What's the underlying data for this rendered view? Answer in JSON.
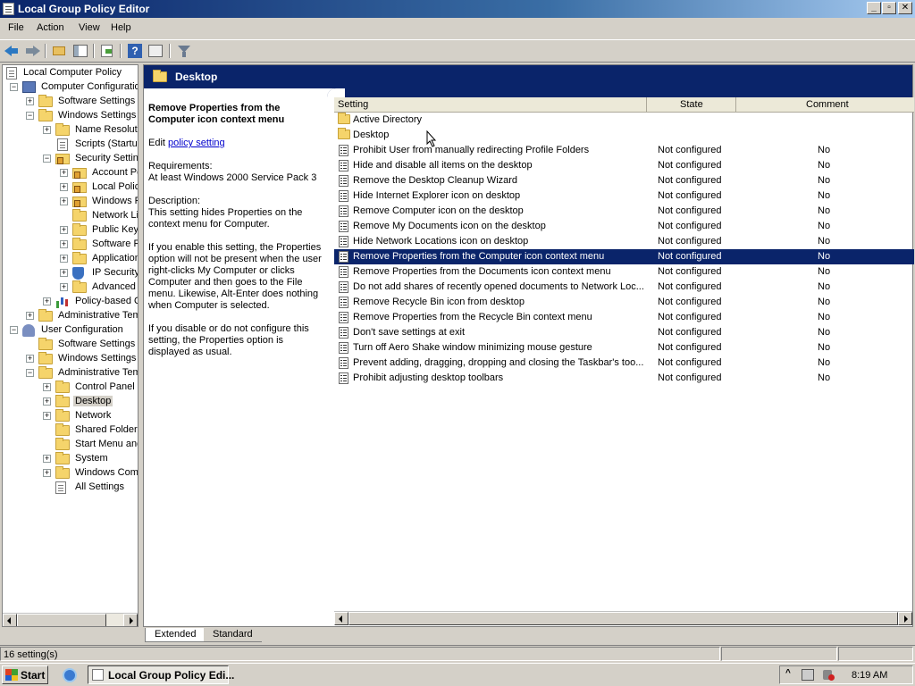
{
  "window": {
    "title": "Local Group Policy Editor"
  },
  "menu": [
    "File",
    "Action",
    "View",
    "Help"
  ],
  "toolbar": {
    "icons": [
      "back-arrow-icon",
      "forward-arrow-icon",
      "up-folder-icon",
      "show-hide-tree-icon",
      "export-list-icon",
      "help-icon",
      "properties-icon",
      "filter-icon"
    ]
  },
  "tree": [
    {
      "label": "Local Computer Policy",
      "icon": "policy-doc-icon"
    },
    {
      "label": "Computer Configuratio",
      "icon": "computer-icon"
    },
    {
      "label": "Software Settings",
      "icon": "folder-icon"
    },
    {
      "label": "Windows Settings",
      "icon": "folder-icon"
    },
    {
      "label": "Name Resolutic",
      "icon": "folder-icon"
    },
    {
      "label": "Scripts (Startu",
      "icon": "script-doc-icon"
    },
    {
      "label": "Security Settin",
      "icon": "lock-folder-icon"
    },
    {
      "label": "Account Pc",
      "icon": "lock-folder-icon"
    },
    {
      "label": "Local Policie",
      "icon": "lock-folder-icon"
    },
    {
      "label": "Windows F",
      "icon": "lock-folder-icon"
    },
    {
      "label": "Network Lis",
      "icon": "folder-icon"
    },
    {
      "label": "Public Key I",
      "icon": "folder-icon"
    },
    {
      "label": "Software R",
      "icon": "folder-icon"
    },
    {
      "label": "Application",
      "icon": "folder-icon"
    },
    {
      "label": "IP Security",
      "icon": "shield-icon"
    },
    {
      "label": "Advanced",
      "icon": "folder-icon"
    },
    {
      "label": "Policy-based Q",
      "icon": "chart-icon"
    },
    {
      "label": "Administrative Tem",
      "icon": "folder-icon"
    },
    {
      "label": "User Configuration",
      "icon": "user-icon"
    },
    {
      "label": "Software Settings",
      "icon": "folder-icon"
    },
    {
      "label": "Windows Settings",
      "icon": "folder-icon"
    },
    {
      "label": "Administrative Tem",
      "icon": "folder-icon"
    },
    {
      "label": "Control Panel",
      "icon": "folder-icon"
    },
    {
      "label": "Desktop",
      "icon": "folder-icon"
    },
    {
      "label": "Network",
      "icon": "folder-icon"
    },
    {
      "label": "Shared Folders",
      "icon": "folder-icon"
    },
    {
      "label": "Start Menu and",
      "icon": "folder-icon"
    },
    {
      "label": "System",
      "icon": "folder-icon"
    },
    {
      "label": "Windows Comp",
      "icon": "folder-icon"
    },
    {
      "label": "All Settings",
      "icon": "all-settings-icon"
    }
  ],
  "right_pane": {
    "header_title": "Desktop",
    "description": {
      "title": "Remove Properties from the Computer icon context menu",
      "edit_prefix": "Edit",
      "edit_link": "policy setting",
      "requirements_label": "Requirements:",
      "requirements": "At least Windows 2000 Service Pack 3",
      "description_label": "Description:",
      "description": "This setting hides Properties on the context menu for Computer.",
      "para_enable": "If you enable this setting, the Properties option will not be present when the user right-clicks My Computer or clicks Computer and then goes to the File menu.  Likewise, Alt-Enter does nothing when Computer is selected.",
      "para_disable": "If you disable or do not configure this setting, the Properties option is displayed as usual."
    },
    "columns": [
      "Setting",
      "State",
      "Comment"
    ],
    "rows": [
      {
        "name": "Active Directory",
        "state": "",
        "comment": "",
        "type": "folder"
      },
      {
        "name": "Desktop",
        "state": "",
        "comment": "",
        "type": "folder"
      },
      {
        "name": "Prohibit User from manually redirecting Profile Folders",
        "state": "Not configured",
        "comment": "No",
        "type": "setting"
      },
      {
        "name": "Hide and disable all items on the desktop",
        "state": "Not configured",
        "comment": "No",
        "type": "setting"
      },
      {
        "name": "Remove the Desktop Cleanup Wizard",
        "state": "Not configured",
        "comment": "No",
        "type": "setting"
      },
      {
        "name": "Hide Internet Explorer icon on desktop",
        "state": "Not configured",
        "comment": "No",
        "type": "setting"
      },
      {
        "name": "Remove Computer icon on the desktop",
        "state": "Not configured",
        "comment": "No",
        "type": "setting"
      },
      {
        "name": "Remove My Documents icon on the desktop",
        "state": "Not configured",
        "comment": "No",
        "type": "setting"
      },
      {
        "name": "Hide Network Locations icon on desktop",
        "state": "Not configured",
        "comment": "No",
        "type": "setting"
      },
      {
        "name": "Remove Properties from the Computer icon context menu",
        "state": "Not configured",
        "comment": "No",
        "type": "setting",
        "selected": true
      },
      {
        "name": "Remove Properties from the Documents icon context menu",
        "state": "Not configured",
        "comment": "No",
        "type": "setting"
      },
      {
        "name": "Do not add shares of recently opened documents to Network Loc...",
        "state": "Not configured",
        "comment": "No",
        "type": "setting"
      },
      {
        "name": "Remove Recycle Bin icon from desktop",
        "state": "Not configured",
        "comment": "No",
        "type": "setting"
      },
      {
        "name": "Remove Properties from the Recycle Bin context menu",
        "state": "Not configured",
        "comment": "No",
        "type": "setting"
      },
      {
        "name": "Don't save settings at exit",
        "state": "Not configured",
        "comment": "No",
        "type": "setting"
      },
      {
        "name": "Turn off Aero Shake window minimizing mouse gesture",
        "state": "Not configured",
        "comment": "No",
        "type": "setting"
      },
      {
        "name": "Prevent adding, dragging, dropping and closing the Taskbar's too...",
        "state": "Not configured",
        "comment": "No",
        "type": "setting"
      },
      {
        "name": "Prohibit adjusting desktop toolbars",
        "state": "Not configured",
        "comment": "No",
        "type": "setting"
      }
    ]
  },
  "tabs": [
    "Extended",
    "Standard"
  ],
  "status": {
    "count": "16 setting(s)"
  },
  "taskbar": {
    "start_label": "Start",
    "task_label": "Local Group Policy Edi...",
    "clock": "8:19 AM"
  },
  "colors": {
    "selection": "#0a246a",
    "link": "#0000cc",
    "titlebar_start": "#0a246a"
  }
}
